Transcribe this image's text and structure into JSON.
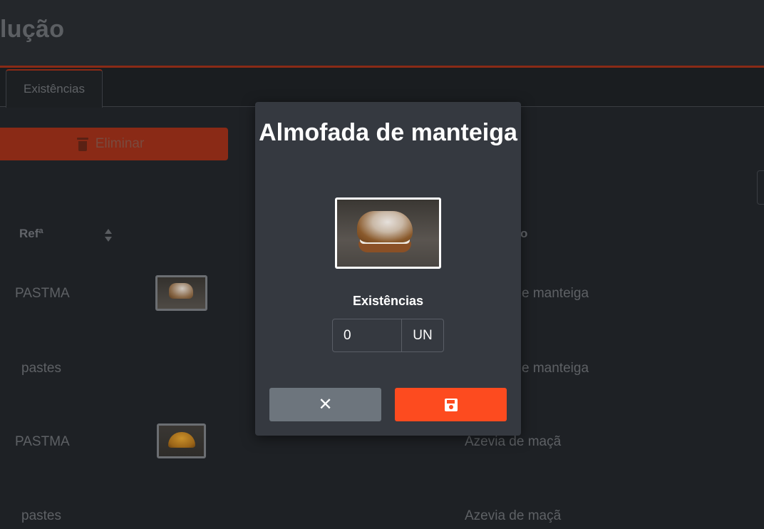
{
  "header": {
    "title": "lução"
  },
  "tabs": [
    {
      "label": "Existências"
    }
  ],
  "toolbar": {
    "delete_label": "Eliminar"
  },
  "table": {
    "columns": [
      {
        "label": "Refª"
      },
      {
        "label": "o"
      }
    ],
    "rows": [
      {
        "ref": "PASTMA",
        "description": "e manteiga",
        "has_image": true
      },
      {
        "ref": "pastes",
        "description": "e manteiga",
        "has_image": false
      },
      {
        "ref": "PASTMA",
        "description": "Azevia de maçã",
        "has_image": true
      },
      {
        "ref": "pastes",
        "description": "Azevia de maçã",
        "has_image": false
      }
    ]
  },
  "modal": {
    "title": "Almofada de manteiga",
    "stock_label": "Existências",
    "quantity_value": "0",
    "unit": "UN",
    "cancel_icon": "close-icon",
    "save_icon": "save-icon"
  },
  "colors": {
    "accent": "#fd4b1f",
    "danger_dim": "#8a2a16",
    "modal_bg": "#353940",
    "secondary": "#6d757d"
  }
}
